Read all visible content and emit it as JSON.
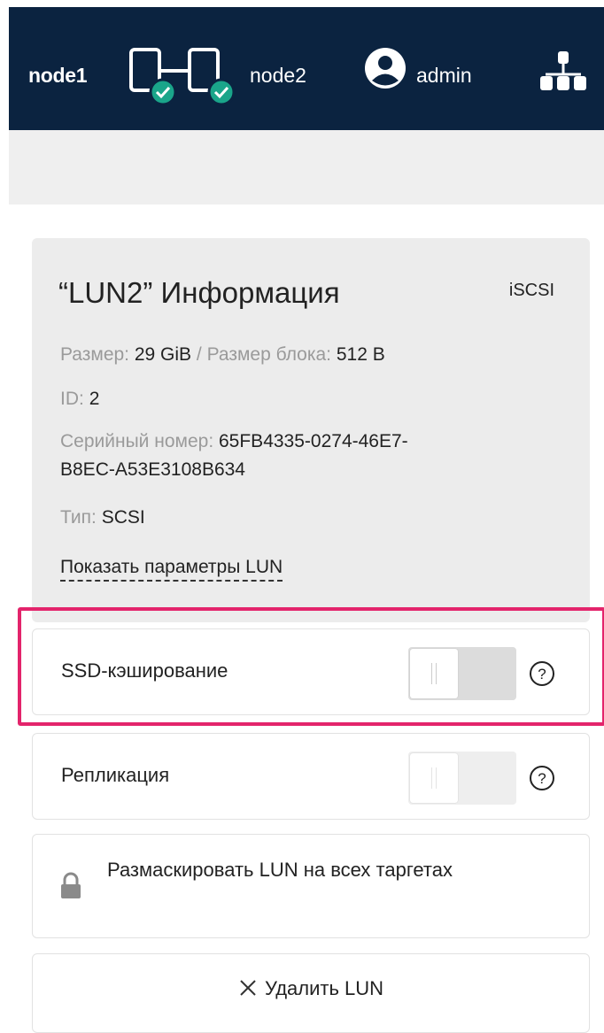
{
  "header": {
    "node1": "node1",
    "node2": "node2",
    "user": "admin"
  },
  "lun_info": {
    "title": "“LUN2” Информация",
    "protocol": "iSCSI",
    "size_label": "Размер:",
    "size_value": "29 GiB",
    "separator": "/",
    "block_label": "Размер блока:",
    "block_value": "512 B",
    "id_label": "ID:",
    "id_value": "2",
    "serial_label": "Серийный номер:",
    "serial_value_1": "65FB4335-0274-46E7-",
    "serial_value_2": "B8EC-A53E3108B634",
    "type_label": "Тип:",
    "type_value": "SCSI",
    "show_params": "Показать параметры LUN"
  },
  "options": {
    "ssd_cache": {
      "label": "SSD-кэширование",
      "enabled": false
    },
    "replication": {
      "label": "Репликация",
      "enabled": false
    }
  },
  "actions": {
    "unmask": "Размаскировать LUN на всех таргетах",
    "delete": "Удалить LUN"
  },
  "colors": {
    "header_bg": "#0b2340",
    "highlight": "#e3246b",
    "check_badge": "#1aa58a"
  }
}
